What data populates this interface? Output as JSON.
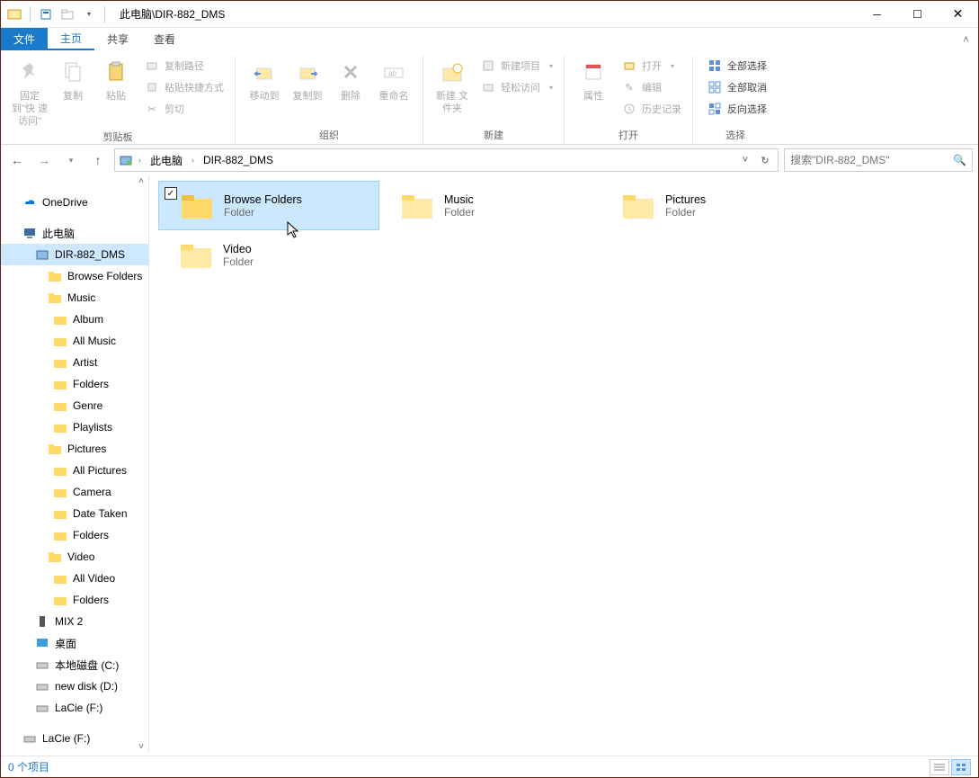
{
  "titlebar": {
    "title": "此电脑\\DIR-882_DMS"
  },
  "menus": {
    "file": "文件",
    "home": "主页",
    "share": "共享",
    "view": "查看"
  },
  "ribbon": {
    "pin": "固定到\"快\n速访问\"",
    "copy": "复制",
    "paste": "粘贴",
    "copypath": "复制路径",
    "pasteshortcut": "粘贴快捷方式",
    "cut": "剪切",
    "clipboard_label": "剪贴板",
    "moveto": "移动到",
    "copyto": "复制到",
    "delete": "删除",
    "rename": "重命名",
    "organize_label": "组织",
    "newfolder": "新建\n文件夹",
    "newitem": "新建项目",
    "easyaccess": "轻松访问",
    "new_label": "新建",
    "properties": "属性",
    "open": "打开",
    "edit": "编辑",
    "history": "历史记录",
    "open_label": "打开",
    "selectall": "全部选择",
    "selectnone": "全部取消",
    "invert": "反向选择",
    "select_label": "选择"
  },
  "address": {
    "seg1": "此电脑",
    "seg2": "DIR-882_DMS"
  },
  "search": {
    "placeholder": "搜索\"DIR-882_DMS\""
  },
  "tree": {
    "onedrive": "OneDrive",
    "thispc": "此电脑",
    "dir882": "DIR-882_DMS",
    "browsefolders": "Browse Folders",
    "music": "Music",
    "album": "Album",
    "allmusic": "All Music",
    "artist": "Artist",
    "folders1": "Folders",
    "genre": "Genre",
    "playlists": "Playlists",
    "pictures": "Pictures",
    "allpictures": "All Pictures",
    "camera": "Camera",
    "datetaken": "Date Taken",
    "folders2": "Folders",
    "video": "Video",
    "allvideo": "All Video",
    "folders3": "Folders",
    "mix2": "MIX 2",
    "desktop": "桌面",
    "diskc": "本地磁盘 (C:)",
    "diskd": "new disk (D:)",
    "diskf1": "LaCie (F:)",
    "diskf2": "LaCie (F:)"
  },
  "tiles": {
    "browsefolders": "Browse Folders",
    "music": "Music",
    "pictures": "Pictures",
    "video": "Video",
    "typefolder": "Folder"
  },
  "status": {
    "count": "0 个项目"
  }
}
